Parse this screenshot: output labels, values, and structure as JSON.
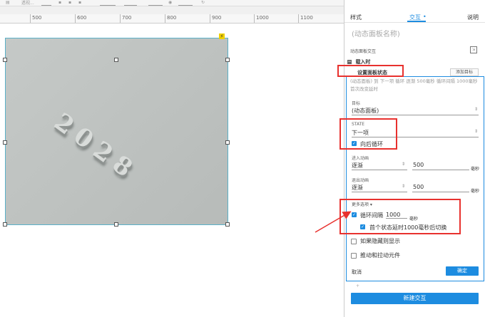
{
  "toolbar": {
    "label": "透视...",
    "icons": [
      "align-icon",
      "bold-icon",
      "color-icon",
      "settings-icon"
    ]
  },
  "ruler": {
    "labels": [
      "500",
      "600",
      "700",
      "800",
      "900",
      "1000",
      "1100"
    ]
  },
  "canvas": {
    "art_text": "2028"
  },
  "panel": {
    "tabs": {
      "style": "样式",
      "interaction": "交互",
      "notes": "说明"
    },
    "widget_name": "(动态面板名称)",
    "section_label": "动态面板交互",
    "event": "载入时",
    "action": "设置面板状态",
    "add_target": "添加目标",
    "summary": "(动态面板) 到 下一项 循环 逐渐 500毫秒 循环间隔 1000毫秒首次改变延时",
    "target": {
      "label": "目标",
      "value": "(动态面板)"
    },
    "state": {
      "label": "STATE",
      "value": "下一项",
      "wrap_label": "向后循环"
    },
    "enter_anim": {
      "label": "进入动画",
      "value": "逐渐",
      "duration": "500",
      "unit": "毫秒"
    },
    "exit_anim": {
      "label": "退出动画",
      "value": "逐渐",
      "duration": "500",
      "unit": "毫秒"
    },
    "more_options": "更多选项 ▾",
    "loop_interval": {
      "label": "循环间隔",
      "value": "1000",
      "unit": "毫秒"
    },
    "first_delay_label": "首个状态延时1000毫秒后切换",
    "show_if_hidden": "如果隐藏则显示",
    "push_pull": "推动和拉动元件",
    "cancel": "取消",
    "ok": "确定",
    "plus": "+",
    "new_interaction": "新建交互"
  },
  "colors": {
    "accent": "#1d8ce0",
    "highlight": "#e8312e",
    "selection": "#5ab1c9"
  }
}
